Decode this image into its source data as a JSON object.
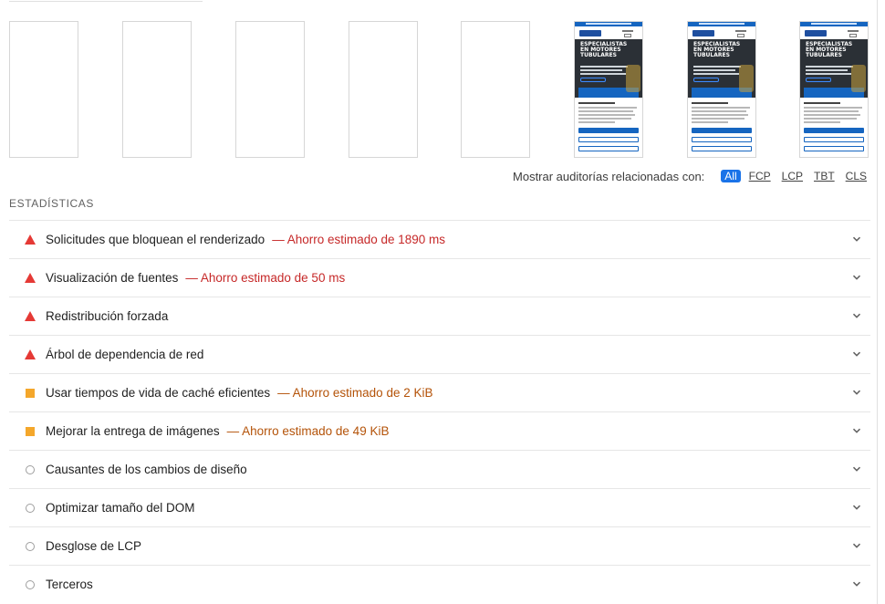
{
  "filmstrip": {
    "page_header_title": "ESPECIALISTAS EN MOTORES TUBULARES"
  },
  "filters": {
    "label": "Mostrar auditorías relacionadas con:",
    "chips": [
      {
        "label": "All",
        "active": true
      },
      {
        "label": "FCP",
        "active": false
      },
      {
        "label": "LCP",
        "active": false
      },
      {
        "label": "TBT",
        "active": false
      },
      {
        "label": "CLS",
        "active": false
      }
    ]
  },
  "section": {
    "title": "ESTADÍSTICAS"
  },
  "audits": [
    {
      "status": "fail",
      "title": "Solicitudes que bloquean el renderizado",
      "savings": "— Ahorro estimado de 1890 ms"
    },
    {
      "status": "fail",
      "title": "Visualización de fuentes",
      "savings": "— Ahorro estimado de 50 ms"
    },
    {
      "status": "fail",
      "title": "Redistribución forzada",
      "savings": ""
    },
    {
      "status": "fail",
      "title": "Árbol de dependencia de red",
      "savings": ""
    },
    {
      "status": "average",
      "title": "Usar tiempos de vida de caché eficientes",
      "savings": "— Ahorro estimado de 2 KiB"
    },
    {
      "status": "average",
      "title": "Mejorar la entrega de imágenes",
      "savings": "— Ahorro estimado de 49 KiB"
    },
    {
      "status": "info",
      "title": "Causantes de los cambios de diseño",
      "savings": ""
    },
    {
      "status": "info",
      "title": "Optimizar tamaño del DOM",
      "savings": ""
    },
    {
      "status": "info",
      "title": "Desglose de LCP",
      "savings": ""
    },
    {
      "status": "info",
      "title": "Terceros",
      "savings": ""
    }
  ],
  "colors": {
    "fail": "#e53935",
    "average": "#f4a72b",
    "info": "#9e9e9e",
    "accent": "#1a73e8"
  }
}
